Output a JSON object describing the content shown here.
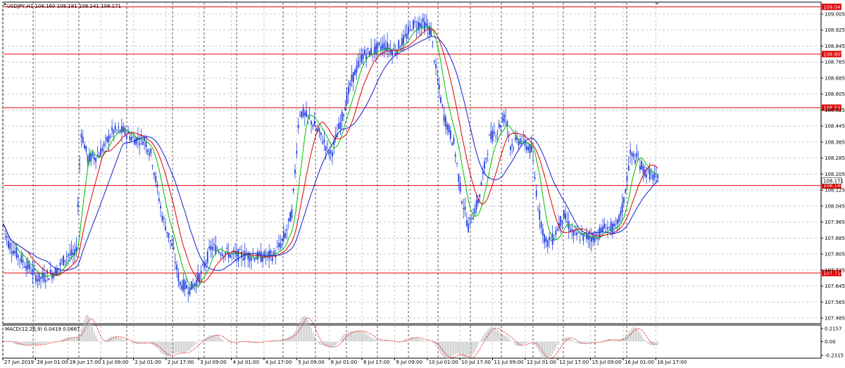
{
  "main_chart": {
    "title": "USDJPY,H1  108.160 108.181 108.141 108.171",
    "price_labels": [
      "109.005",
      "108.925",
      "108.845",
      "108.765",
      "108.685",
      "108.605",
      "108.525",
      "108.445",
      "108.365",
      "108.285",
      "108.205",
      "108.125",
      "108.045",
      "107.965",
      "107.885",
      "107.805",
      "107.725",
      "107.645",
      "107.565",
      "107.485"
    ],
    "horizontal_lines": [
      {
        "label": "109.041"
      },
      {
        "label": "108.805"
      },
      {
        "label": "108.537"
      },
      {
        "label": "108.148"
      },
      {
        "label": "107.710"
      }
    ],
    "current_price": "108.171",
    "line_color": "#e00000",
    "candle_color": "#2040e0"
  },
  "macd": {
    "title": "MACD(12,26,9) 0.0419 0.0667",
    "labels": [
      "0.2157",
      "0.00",
      "-0.2315"
    ]
  },
  "time_labels": [
    "27 Jun 2019",
    "28 Jun 01:00",
    "28 Jun 17:00",
    "1 Jul 09:00",
    "2 Jul 01:00",
    "2 Jul 17:00",
    "3 Jul 09:00",
    "4 Jul 01:00",
    "4 Jul 17:00",
    "5 Jul 09:00",
    "8 Jul 01:00",
    "8 Jul 17:00",
    "9 Jul 09:00",
    "10 Jul 01:00",
    "10 Jul 17:00",
    "11 Jul 09:00",
    "12 Jul 01:00",
    "12 Jul 17:00",
    "15 Jul 09:00",
    "16 Jul 01:00",
    "16 Jul 17:00"
  ]
}
